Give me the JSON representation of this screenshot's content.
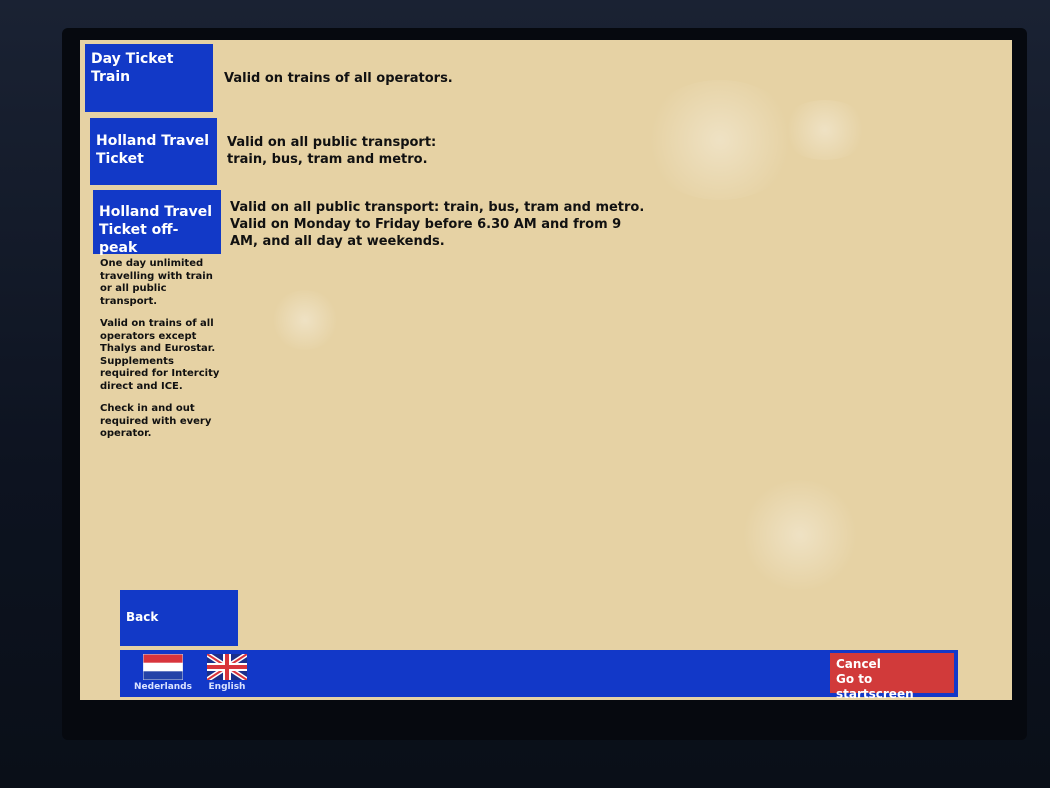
{
  "tickets": [
    {
      "label_lines": [
        "Day Ticket",
        "Train"
      ],
      "description_lines": [
        "Valid on trains of all operators."
      ]
    },
    {
      "label_lines": [
        "Holland Travel",
        "Ticket"
      ],
      "description_lines": [
        "Valid on all public transport:",
        "train, bus, tram and metro."
      ]
    },
    {
      "label_lines": [
        "Holland Travel",
        "Ticket off-peak"
      ],
      "description_lines": [
        "Valid on all public transport: train, bus, tram and metro.",
        "Valid on Monday to Friday before 6.30 AM and from 9",
        "AM, and all day at weekends."
      ]
    }
  ],
  "sidebar_info": {
    "paragraphs": [
      "One day unlimited\ntravelling with train\nor all public\ntransport.",
      "Valid on trains of all\noperators except\nThalys and Eurostar.\nSupplements\nrequired for Intercity\ndirect and ICE.",
      "Check in and out\nrequired with every\noperator."
    ]
  },
  "back_button": {
    "label": "Back"
  },
  "languages": [
    {
      "label": "Nederlands",
      "icon": "dutch-flag-icon"
    },
    {
      "label": "English",
      "icon": "uk-flag-icon"
    }
  ],
  "cancel_button": {
    "line1": "Cancel",
    "line2": "Go to startscreen"
  },
  "colors": {
    "tile_blue": "#1239c7",
    "screen_background": "#e6d2a4",
    "cancel_red": "#d13a3a"
  }
}
